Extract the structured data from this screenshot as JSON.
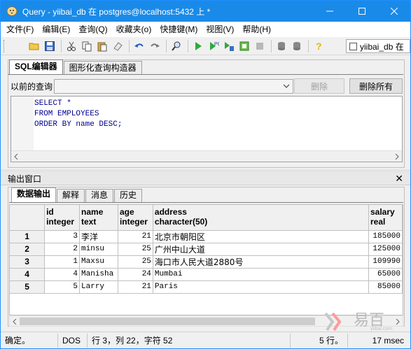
{
  "window": {
    "title": "Query - yiibai_db 在  postgres@localhost:5432 上 *"
  },
  "menu": {
    "items": [
      {
        "name": "menu-file",
        "label": "文件(F)"
      },
      {
        "name": "menu-edit",
        "label": "编辑(E)"
      },
      {
        "name": "menu-query",
        "label": "查询(Q)"
      },
      {
        "name": "menu-favorites",
        "label": "收藏夹(o)"
      },
      {
        "name": "menu-shortcuts",
        "label": "快捷键(M)"
      },
      {
        "name": "menu-view",
        "label": "视图(V)"
      },
      {
        "name": "menu-help",
        "label": "帮助(H)"
      }
    ]
  },
  "toolbar": {
    "db_selector": "yiibai_db 在"
  },
  "editor": {
    "tabs": [
      "SQL编辑器",
      "图形化查询构造器"
    ],
    "previous_query_label": "以前的查询",
    "delete_label": "删除",
    "delete_all_label": "删除所有",
    "sql_lines": [
      "SELECT *",
      "FROM EMPLOYEES",
      "ORDER BY name DESC;"
    ]
  },
  "output": {
    "title": "输出窗口",
    "tabs": [
      "数据输出",
      "解释",
      "消息",
      "历史"
    ],
    "columns": [
      {
        "name": "id",
        "type": "integer"
      },
      {
        "name": "name",
        "type": "text"
      },
      {
        "name": "age",
        "type": "integer"
      },
      {
        "name": "address",
        "type": "character(50)"
      },
      {
        "name": "salary",
        "type": "real"
      }
    ],
    "rows": [
      {
        "n": "1",
        "id": "3",
        "name": "李洋",
        "age": "21",
        "address": "北京市朝阳区",
        "salary": "185000"
      },
      {
        "n": "2",
        "id": "2",
        "name": "minsu",
        "age": "25",
        "address": "广州中山大道",
        "salary": "125000"
      },
      {
        "n": "3",
        "id": "1",
        "name": "Maxsu",
        "age": "25",
        "address": "海口市人民大道2880号",
        "salary": "109990"
      },
      {
        "n": "4",
        "id": "4",
        "name": "Manisha",
        "age": "24",
        "address": "Mumbai",
        "salary": "65000"
      },
      {
        "n": "5",
        "id": "5",
        "name": "Larry",
        "age": "21",
        "address": "Paris",
        "salary": "85000"
      }
    ]
  },
  "watermark": {
    "text": "易百",
    "url": "yiibai.com"
  },
  "status": {
    "state": "确定。",
    "line_ending": "DOS",
    "cursor": "行 3，列 22，字符 52",
    "rows": "5 行。",
    "time": "17 msec"
  }
}
